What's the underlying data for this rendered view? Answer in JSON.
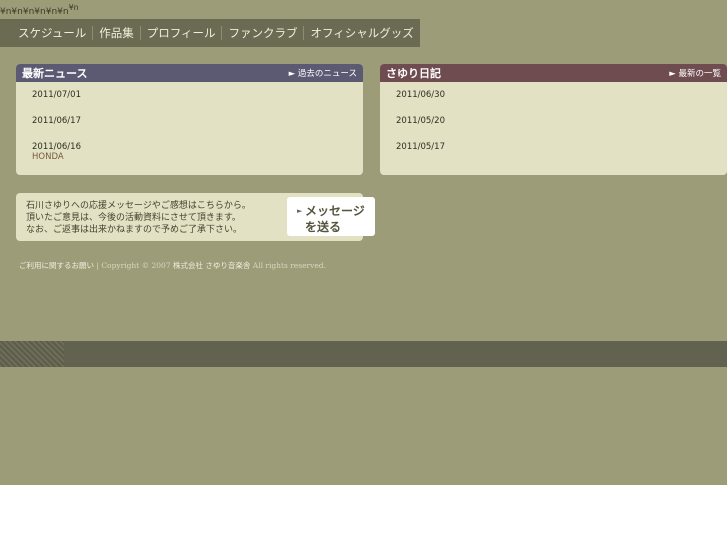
{
  "garbage_text": "¥n¥n¥n¥n¥n¥n",
  "garbage_sup": "¥n",
  "nav": {
    "items": [
      "スケジュール",
      "作品集",
      "プロフィール",
      "ファンクラブ",
      "オフィシャルグッズ"
    ]
  },
  "news": {
    "title": "最新ニュース",
    "more": "► 過去のニュース",
    "entries": [
      {
        "date": "2011/07/01",
        "sub": ""
      },
      {
        "date": "2011/06/17",
        "sub": ""
      },
      {
        "date": "2011/06/16",
        "sub": "HONDA"
      }
    ]
  },
  "diary": {
    "title": "さゆり日記",
    "more": "► 最新の一覧",
    "entries": [
      {
        "date": "2011/06/30"
      },
      {
        "date": "2011/05/20"
      },
      {
        "date": "2011/05/17"
      }
    ]
  },
  "message": {
    "line1": "石川さゆりへの応援メッセージやご感想はこちらから。",
    "line2": "頂いたご意見は、今後の活動資料にさせて頂きます。",
    "line3": "なお、ご返事は出来かねますので予めご了承下さい。",
    "button_line1": "メッセージ",
    "button_line2": "を送る",
    "button_arrow": "►"
  },
  "footer": {
    "terms": "ご利用に関するお願い",
    "separator": "|",
    "copyright": "Copyright © 2007",
    "company": "株式会社 さゆり音楽舎",
    "rights": "All rights reserved."
  }
}
